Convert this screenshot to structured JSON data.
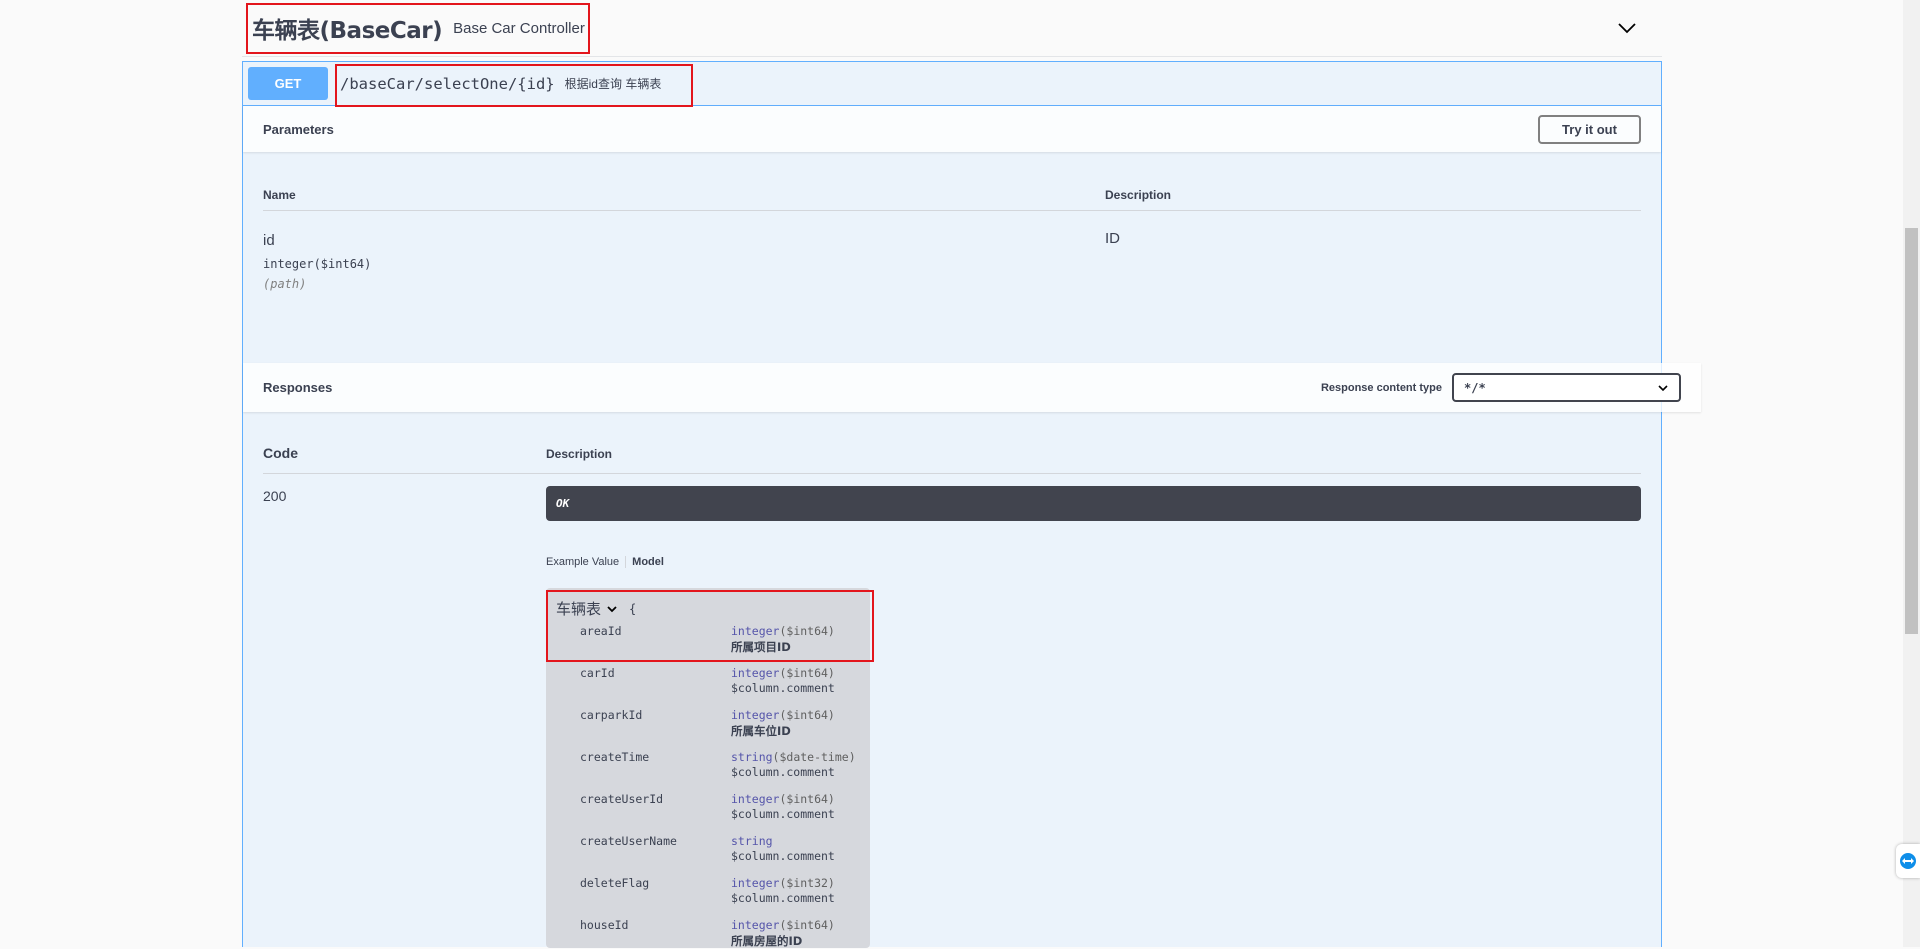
{
  "tag": {
    "name": "车辆表(BaseCar)",
    "description": "Base Car Controller"
  },
  "operation": {
    "method": "GET",
    "path": "/baseCar/selectOne/{id}",
    "summary": "根据id查询 车辆表"
  },
  "parameters": {
    "title": "Parameters",
    "try_label": "Try it out",
    "col_name": "Name",
    "col_description": "Description",
    "items": [
      {
        "name": "id",
        "type": "integer($int64)",
        "in": "(path)",
        "description": "ID"
      }
    ]
  },
  "responses": {
    "title": "Responses",
    "content_type_label": "Response content type",
    "content_type_value": "*/*",
    "col_code": "Code",
    "col_description": "Description",
    "code": "200",
    "ok": "OK",
    "tab_example": "Example Value",
    "tab_model": "Model"
  },
  "model": {
    "name": "车辆表",
    "brace": "{",
    "properties": [
      {
        "name": "areaId",
        "prim": "integer",
        "fmt": "($int64)",
        "desc": "所属项目ID"
      },
      {
        "name": "carId",
        "prim": "integer",
        "fmt": "($int64)",
        "desc": "$column.comment"
      },
      {
        "name": "carparkId",
        "prim": "integer",
        "fmt": "($int64)",
        "desc": "所属车位ID"
      },
      {
        "name": "createTime",
        "prim": "string",
        "fmt": "($date-time)",
        "desc": "$column.comment"
      },
      {
        "name": "createUserId",
        "prim": "integer",
        "fmt": "($int64)",
        "desc": "$column.comment"
      },
      {
        "name": "createUserName",
        "prim": "string",
        "fmt": "",
        "desc": "$column.comment"
      },
      {
        "name": "deleteFlag",
        "prim": "integer",
        "fmt": "($int32)",
        "desc": "$column.comment"
      },
      {
        "name": "houseId",
        "prim": "integer",
        "fmt": "($int64)",
        "desc": "所属房屋的ID"
      }
    ]
  },
  "colors": {
    "get_blue": "#61affe",
    "highlight_red": "#e3151c",
    "op_bg": "#ebf3fb",
    "ok_bar": "#41444e"
  }
}
